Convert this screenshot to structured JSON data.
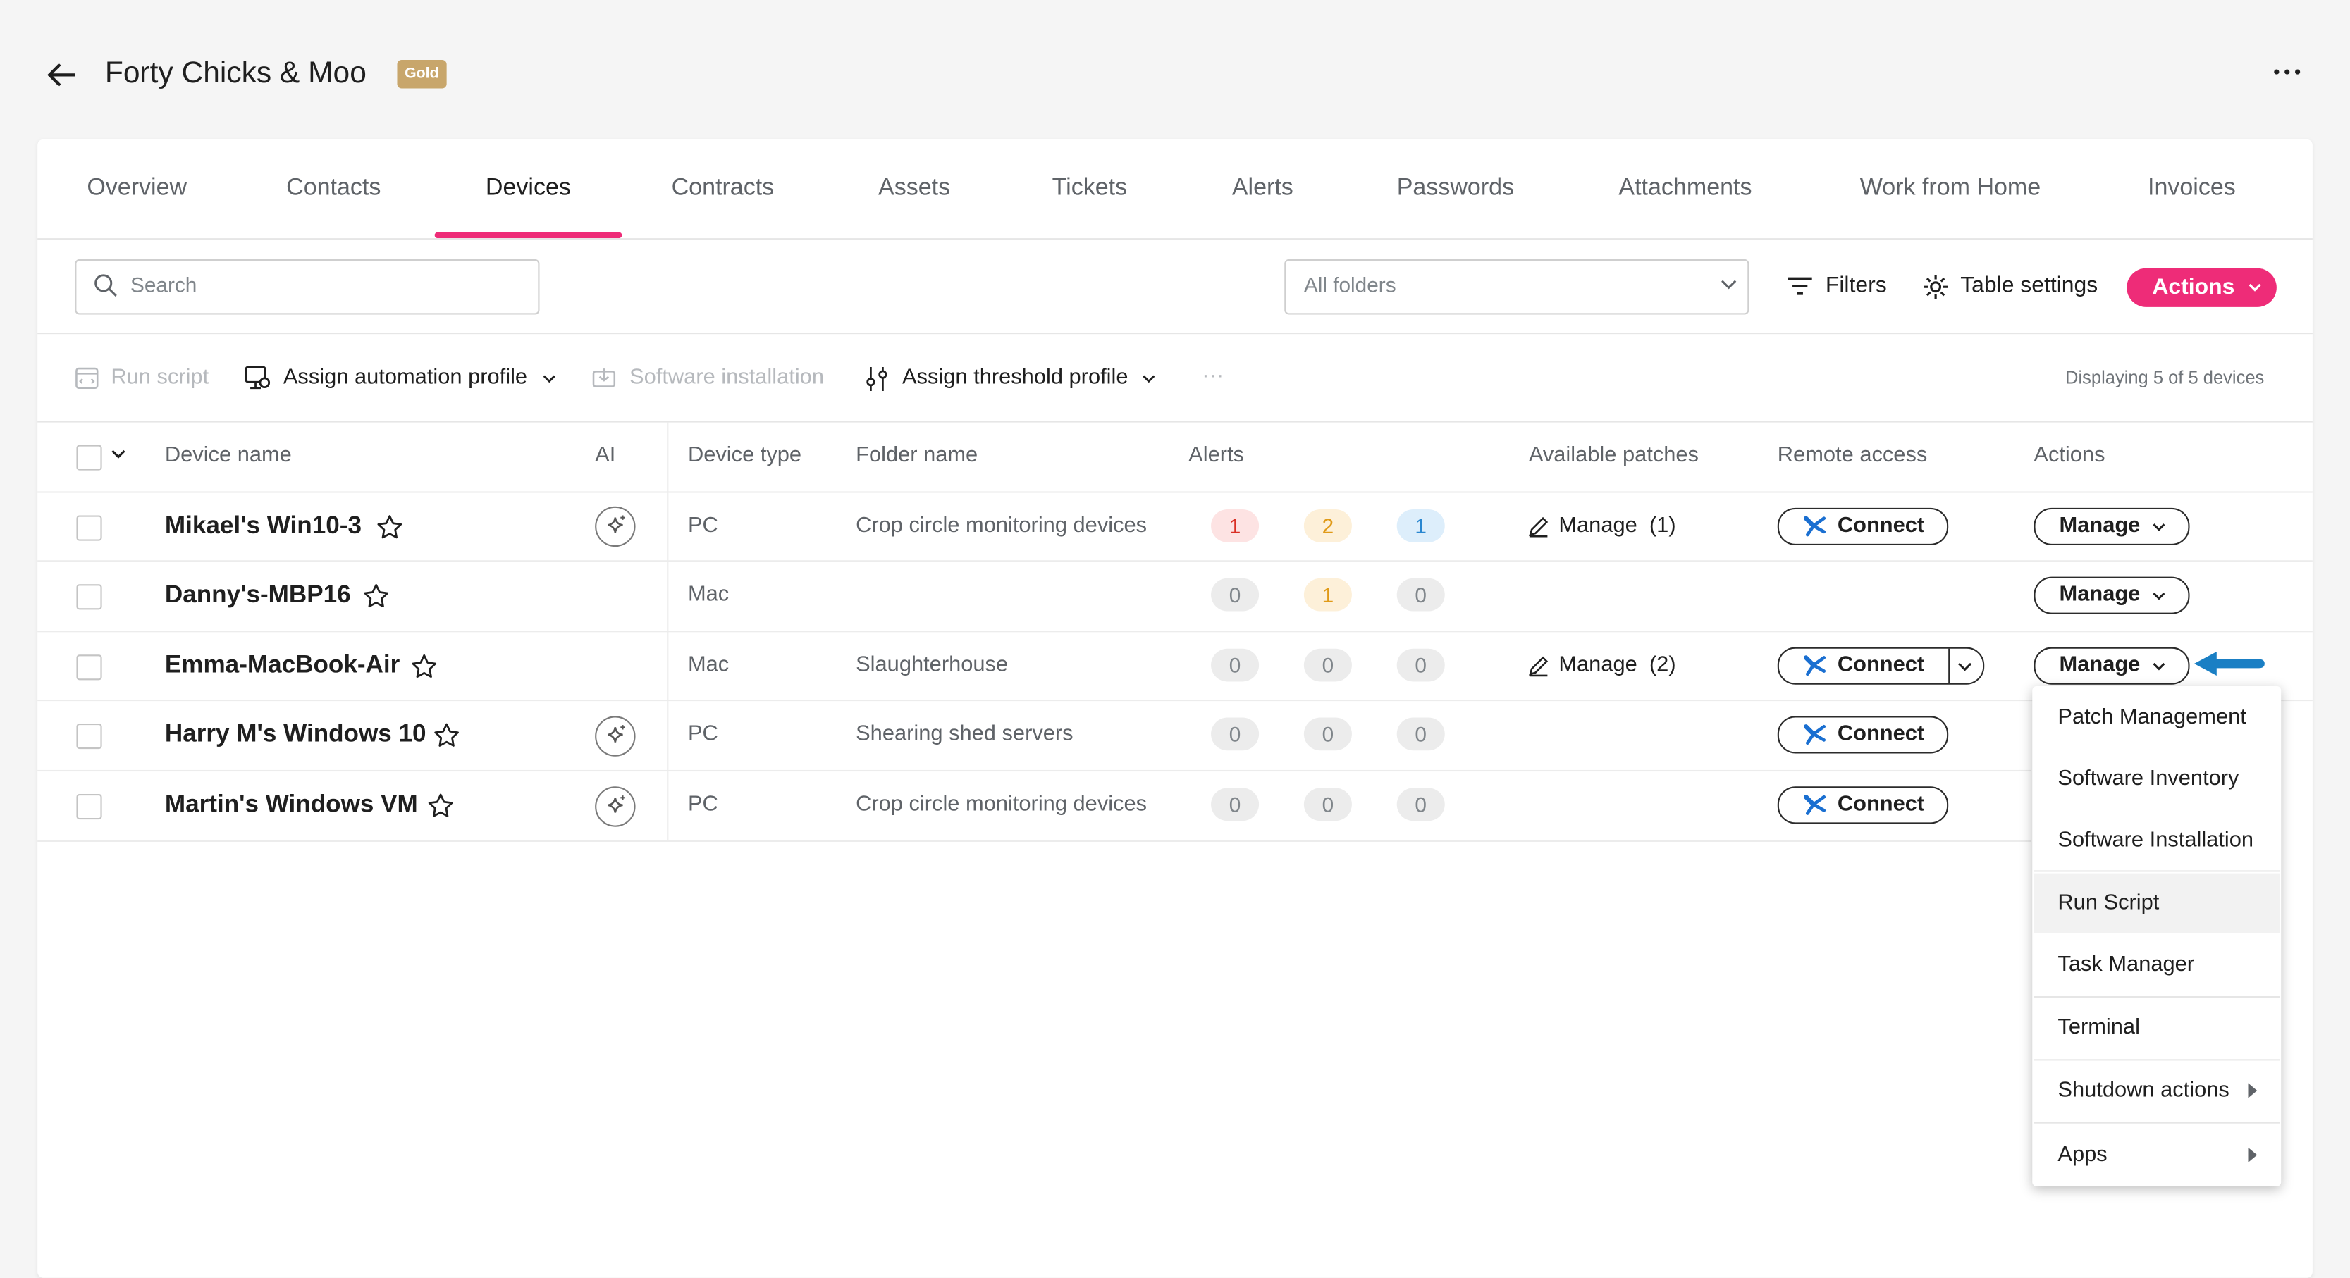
{
  "header": {
    "title": "Forty Chicks & Moo",
    "badge": "Gold",
    "back_icon": "arrow-left-icon",
    "more_icon": "ellipsis-icon"
  },
  "tabs": [
    {
      "label": "Overview",
      "active": false
    },
    {
      "label": "Contacts",
      "active": false
    },
    {
      "label": "Devices",
      "active": true
    },
    {
      "label": "Contracts",
      "active": false
    },
    {
      "label": "Assets",
      "active": false
    },
    {
      "label": "Tickets",
      "active": false
    },
    {
      "label": "Alerts",
      "active": false
    },
    {
      "label": "Passwords",
      "active": false
    },
    {
      "label": "Attachments",
      "active": false
    },
    {
      "label": "Work from Home",
      "active": false
    },
    {
      "label": "Invoices",
      "active": false
    }
  ],
  "toolbar": {
    "search_placeholder": "Search",
    "folder_select": "All folders",
    "filters": "Filters",
    "table_settings": "Table settings",
    "actions": "Actions"
  },
  "bulk_actions": {
    "run_script": "Run script",
    "assign_automation_profile": "Assign automation profile",
    "software_installation": "Software installation",
    "assign_threshold_profile": "Assign threshold profile",
    "more": "···",
    "display_count": "Displaying 5 of 5 devices"
  },
  "table": {
    "columns": {
      "device_name": "Device name",
      "ai": "AI",
      "device_type": "Device type",
      "folder_name": "Folder name",
      "alerts": "Alerts",
      "available_patches": "Available patches",
      "remote_access": "Remote access",
      "actions": "Actions"
    },
    "rows": [
      {
        "name": "Mikael's Win10-3",
        "ai": true,
        "type": "PC",
        "folder": "Crop circle monitoring devices",
        "alerts": [
          "1",
          "2",
          "1"
        ],
        "patches": "Manage  (1)",
        "connect": "Connect",
        "manage": "Manage"
      },
      {
        "name": "Danny's-MBP16",
        "ai": false,
        "type": "Mac",
        "folder": "",
        "alerts": [
          "0",
          "1",
          "0"
        ],
        "patches": "",
        "connect": "",
        "manage": "Manage"
      },
      {
        "name": "Emma-MacBook-Air",
        "ai": false,
        "type": "Mac",
        "folder": "Slaughterhouse",
        "alerts": [
          "0",
          "0",
          "0"
        ],
        "patches": "Manage  (2)",
        "connect": "Connect",
        "manage": "Manage"
      },
      {
        "name": "Harry M's Windows 10",
        "ai": true,
        "type": "PC",
        "folder": "Shearing shed servers",
        "alerts": [
          "0",
          "0",
          "0"
        ],
        "patches": "",
        "connect": "Connect",
        "manage": ""
      },
      {
        "name": "Martin's Windows VM",
        "ai": true,
        "type": "PC",
        "folder": "Crop circle monitoring devices",
        "alerts": [
          "0",
          "0",
          "0"
        ],
        "patches": "",
        "connect": "Connect",
        "manage": ""
      }
    ]
  },
  "manage_menu": {
    "items": [
      "Patch Management",
      "Software Inventory",
      "Software Installation",
      "Run Script",
      "Task Manager",
      "Terminal",
      "Shutdown actions",
      "Apps"
    ]
  },
  "colors": {
    "accent": "#ee2c78",
    "badge_gold": "#c8a66b",
    "alert_red": "#d93025",
    "alert_orange": "#e09a18",
    "alert_blue": "#2a87d0",
    "pointer_arrow": "#1a7fc4"
  }
}
